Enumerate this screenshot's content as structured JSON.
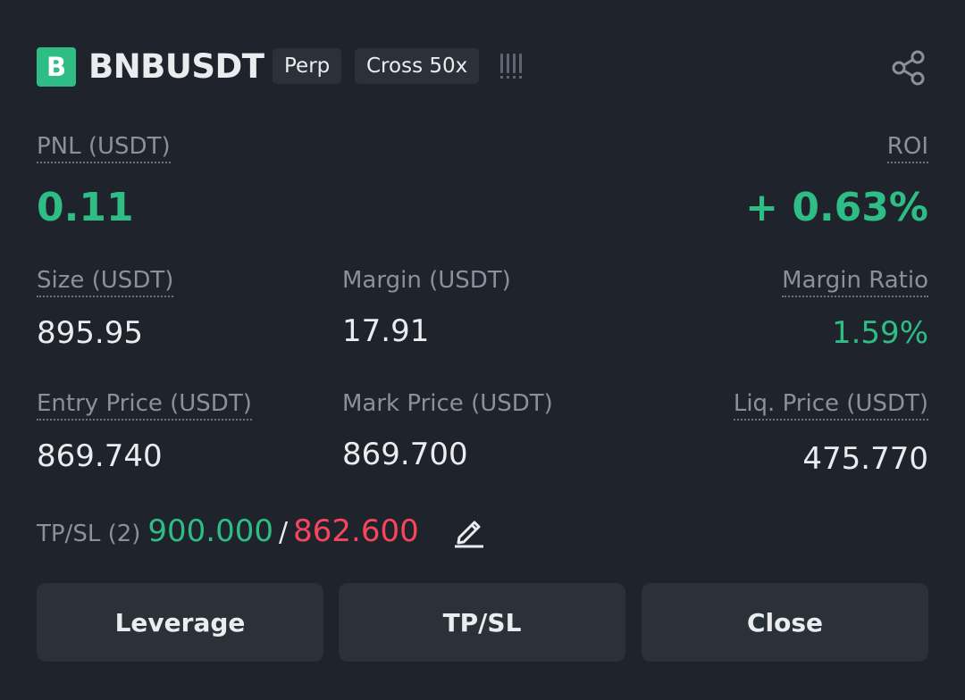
{
  "header": {
    "badge": "B",
    "symbol": "BNBUSDT",
    "tags": {
      "perp": "Perp",
      "cross": "Cross 50x"
    },
    "risk_icon": "risk-level-bars-icon",
    "share_icon": "share-icon"
  },
  "pnl": {
    "label": "PNL (USDT)",
    "value": "0.11",
    "roi_label": "ROI",
    "roi_value": "+ 0.63%"
  },
  "stats": {
    "size_label": "Size (USDT)",
    "size_value": "895.95",
    "margin_label": "Margin (USDT)",
    "margin_value": "17.91",
    "margin_ratio_label": "Margin Ratio",
    "margin_ratio_value": "1.59%",
    "entry_label": "Entry Price (USDT)",
    "entry_value": "869.740",
    "mark_label": "Mark Price (USDT)",
    "mark_value": "869.700",
    "liq_label": "Liq. Price (USDT)",
    "liq_value": "475.770"
  },
  "tpsl": {
    "label": "TP/SL (2)",
    "tp": "900.000",
    "separator": "/",
    "sl": "862.600",
    "edit_icon": "edit-pencil-icon"
  },
  "actions": {
    "leverage": "Leverage",
    "tpsl": "TP/SL",
    "close": "Close"
  },
  "colors": {
    "background": "#1f232b",
    "positive": "#2ebd85",
    "negative": "#f6465d",
    "button_bg": "#2b3139",
    "label": "#8a919c"
  }
}
